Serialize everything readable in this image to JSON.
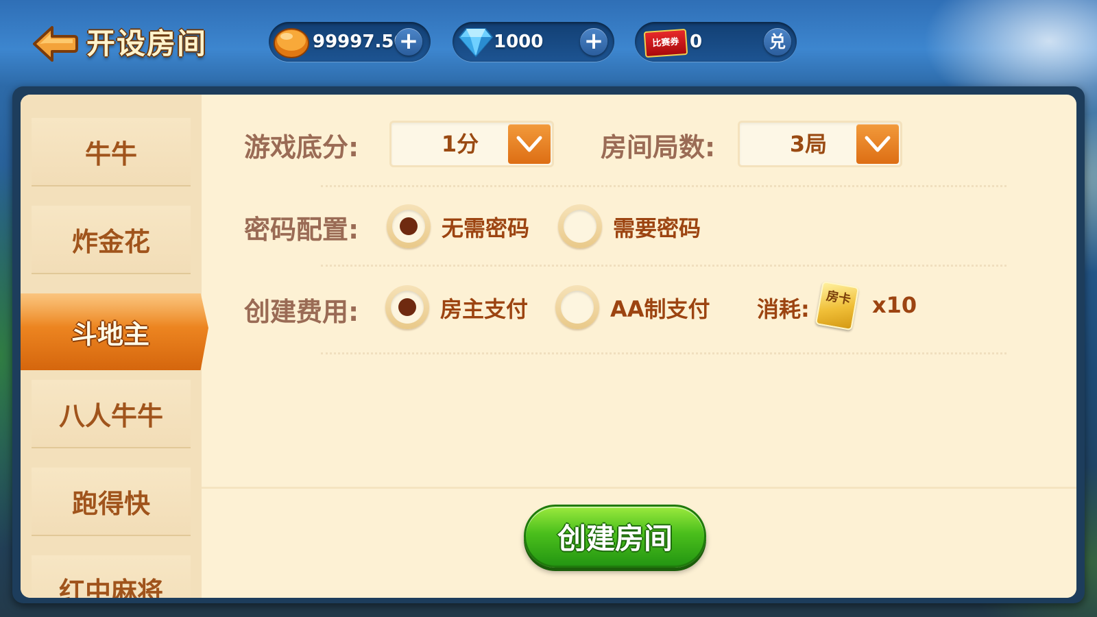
{
  "header": {
    "title": "开设房间",
    "coins": "99997.50",
    "diamonds": "1000",
    "tickets": "0",
    "ticket_icon_text": "比赛券",
    "exchange_label": "兑",
    "plus_label": "+"
  },
  "sidebar": {
    "items": [
      {
        "label": "牛牛"
      },
      {
        "label": "炸金花"
      },
      {
        "label": "斗地主",
        "active": true
      },
      {
        "label": "八人牛牛"
      },
      {
        "label": "跑得快"
      },
      {
        "label": "红中麻将"
      }
    ]
  },
  "form": {
    "base_score": {
      "label": "游戏底分:",
      "value": "1分"
    },
    "rounds": {
      "label": "房间局数:",
      "value": "3局"
    },
    "password": {
      "label": "密码配置:",
      "options": [
        {
          "label": "无需密码",
          "selected": true
        },
        {
          "label": "需要密码",
          "selected": false
        }
      ]
    },
    "fee": {
      "label": "创建费用:",
      "options": [
        {
          "label": "房主支付",
          "selected": true
        },
        {
          "label": "AA制支付",
          "selected": false
        }
      ],
      "consume_label": "消耗:",
      "card_icon_text": "房卡",
      "consume_amount": "x10"
    }
  },
  "create_button": {
    "label": "创建房间"
  },
  "colors": {
    "accent_orange": "#ec8420",
    "create_green": "#4bbf1c",
    "label_brown": "#9a6b55",
    "panel_bg": "#fdf1d4"
  },
  "icons": {
    "back": "back-arrow-icon",
    "coin": "coin-icon",
    "diamond": "diamond-icon",
    "ticket": "ticket-icon",
    "room_card": "room-card-icon"
  }
}
